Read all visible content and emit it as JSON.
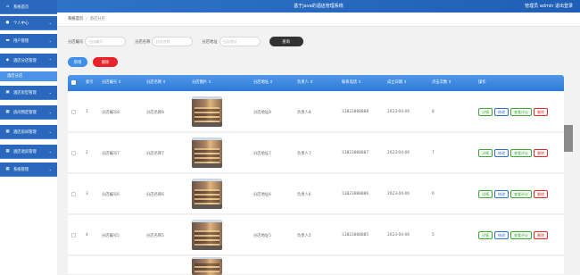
{
  "header": {
    "title": "基于java的酒店管理系统",
    "user_text": "管理员 admin  退出登录"
  },
  "sidebar": {
    "items": [
      {
        "label": "系统首页",
        "icon": "home-icon"
      },
      {
        "label": "个人中心",
        "icon": "user-icon"
      },
      {
        "label": "用户管理",
        "icon": "users-icon"
      },
      {
        "label": "酒店分店管理",
        "icon": "store-icon"
      },
      {
        "label": "酒店分店",
        "sub": true
      },
      {
        "label": "酒店房型管理",
        "icon": "bed-icon"
      },
      {
        "label": "房间预定管理",
        "icon": "grid-icon"
      },
      {
        "label": "酒店房间管理",
        "icon": "grid-icon"
      },
      {
        "label": "酒店退房管理",
        "icon": "grid-icon"
      },
      {
        "label": "系统管理",
        "icon": "grid-icon"
      }
    ]
  },
  "breadcrumb": {
    "home": "系统首页",
    "current": "酒店分店"
  },
  "search": {
    "fields": [
      {
        "label": "分店编号",
        "placeholder": "分店编号"
      },
      {
        "label": "分店名称",
        "placeholder": "分店名称"
      },
      {
        "label": "分店地址",
        "placeholder": "分店地址"
      }
    ],
    "button": "查询"
  },
  "actions": {
    "add": "新增",
    "delete": "删除"
  },
  "table": {
    "headers": [
      "索引",
      "分店编号 ⇕",
      "分店名称 ⇕",
      "分店图片 ⇕",
      "分店地址 ⇕",
      "负责人 ⇕",
      "联系电话 ⇕",
      "成立日期 ⇕",
      "点击次数 ⇕",
      "操作"
    ],
    "rows": [
      {
        "index": "1",
        "code": "分店编号8",
        "name": "分店名称8",
        "address": "分店地址8",
        "manager": "负责人8",
        "phone": "13823888888",
        "date": "2023-04-06",
        "clicks": "8"
      },
      {
        "index": "2",
        "code": "分店编号7",
        "name": "分店名称7",
        "address": "分店地址7",
        "manager": "负责人7",
        "phone": "13823888887",
        "date": "2023-04-06",
        "clicks": "7"
      },
      {
        "index": "3",
        "code": "分店编号6",
        "name": "分店名称6",
        "address": "分店地址6",
        "manager": "负责人6",
        "phone": "13823888886",
        "date": "2023-04-06",
        "clicks": "6"
      },
      {
        "index": "4",
        "code": "分店编号5",
        "name": "分店名称5",
        "address": "分店地址5",
        "manager": "负责人5",
        "phone": "13823888885",
        "date": "2023-04-06",
        "clicks": "5"
      }
    ],
    "row_ops": {
      "detail": "详情",
      "edit": "修改",
      "review": "查看评论",
      "delete": "删除"
    }
  },
  "colors": {
    "sidebar": "#2a68bd",
    "header": "#2f73c9",
    "accent": "#3f8ee8",
    "danger": "#e8222b"
  }
}
